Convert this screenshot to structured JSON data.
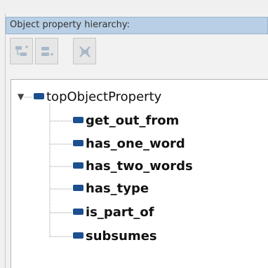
{
  "header": {
    "title": "Object property hierarchy:"
  },
  "toolbar": {
    "buttons": [
      {
        "name": "add-subproperty",
        "icon": "add-subproperty-icon",
        "enabled": false
      },
      {
        "name": "add-sibling-property",
        "icon": "add-sibling-property-icon",
        "enabled": false
      },
      {
        "name": "delete-property",
        "icon": "delete-property-icon",
        "enabled": false
      }
    ]
  },
  "tree": {
    "expander_icon": "▼",
    "root": {
      "label": "topObjectProperty",
      "expanded": true
    },
    "children": [
      {
        "label": "get_out_from"
      },
      {
        "label": "has_one_word"
      },
      {
        "label": "has_two_words"
      },
      {
        "label": "has_type"
      },
      {
        "label": "is_part_of"
      },
      {
        "label": "subsumes"
      }
    ]
  },
  "colors": {
    "title_bar": "#b8cfe5",
    "property_pill": "#1c4f8f",
    "disabled_icon": "#a8b8c8"
  }
}
